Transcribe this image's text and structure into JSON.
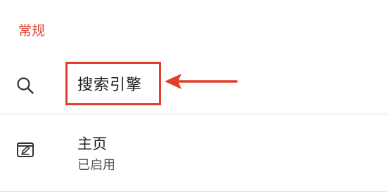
{
  "section": {
    "title": "常规"
  },
  "rows": {
    "search_engine": {
      "title": "搜索引擎",
      "icon": "search-icon"
    },
    "homepage": {
      "title": "主页",
      "subtitle": "已启用",
      "icon": "homepage-icon"
    }
  },
  "annotation": {
    "color": "#e33e2b"
  },
  "colors": {
    "accent": "#e1402a",
    "text": "#1a1a1a",
    "secondary_text": "#555555",
    "divider": "#d9d9d9"
  }
}
